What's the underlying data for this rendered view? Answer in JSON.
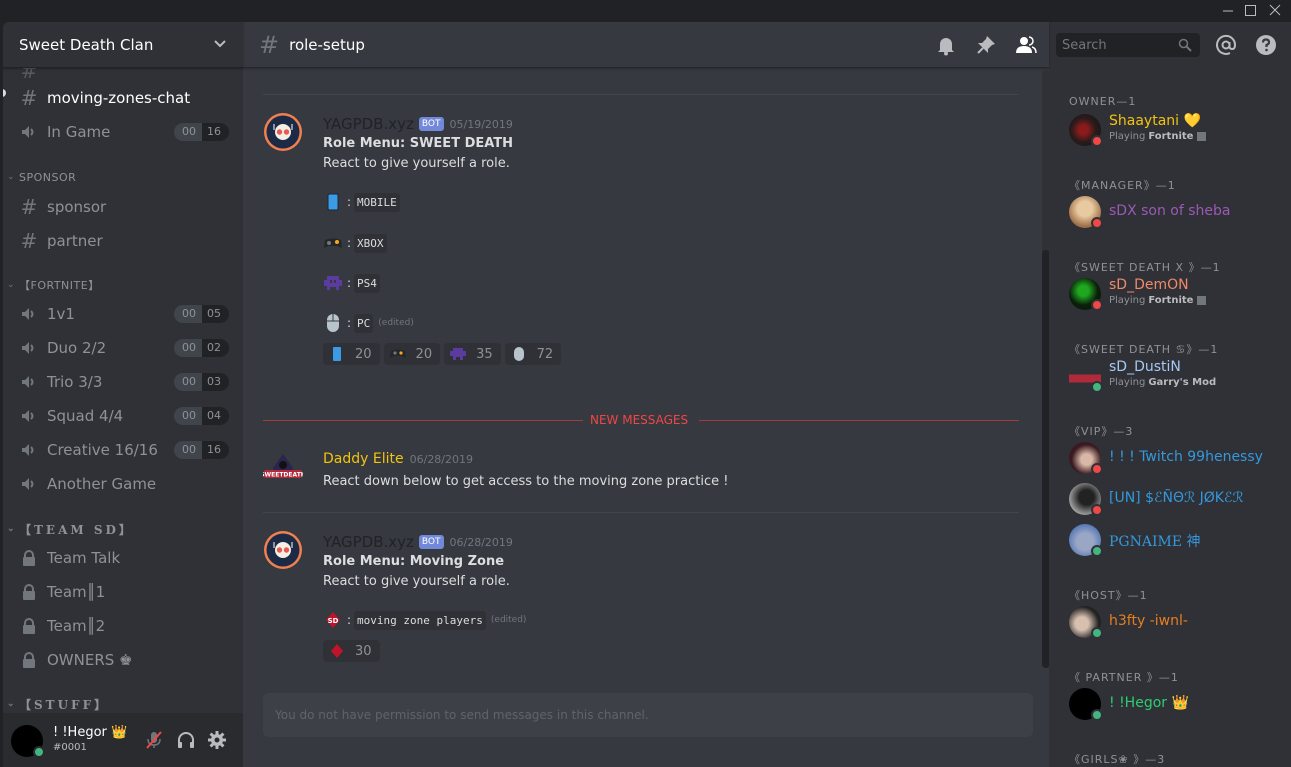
{
  "window": {
    "controls": [
      "minimize",
      "maximize",
      "close"
    ]
  },
  "guild": {
    "name": "Sweet Death Clan"
  },
  "sidebar": {
    "selected_channel": {
      "name": "moving-zones-chat",
      "type": "text"
    },
    "in_game": {
      "name": "In Game",
      "count_a": "00",
      "count_b": "16"
    },
    "categories": {
      "sponsor": "SPONSOR",
      "fortnite": "【FORTNITE】",
      "team_sd": "【TEAM SD】",
      "stuff": "【STUFF】"
    },
    "sponsor_channels": [
      {
        "name": "sponsor",
        "type": "text"
      },
      {
        "name": "partner",
        "type": "text"
      }
    ],
    "fortnite_channels": [
      {
        "name": "1v1",
        "count_a": "00",
        "count_b": "05"
      },
      {
        "name": "Duo 2/2",
        "count_a": "00",
        "count_b": "02"
      },
      {
        "name": "Trio 3/3",
        "count_a": "00",
        "count_b": "03"
      },
      {
        "name": "Squad 4/4",
        "count_a": "00",
        "count_b": "04"
      },
      {
        "name": "Creative 16/16",
        "count_a": "00",
        "count_b": "16"
      },
      {
        "name": "Another Game"
      }
    ],
    "team_channels": [
      {
        "name": "Team Talk"
      },
      {
        "name": "Team║1"
      },
      {
        "name": "Team║2"
      },
      {
        "name": "OWNERS ♚"
      }
    ]
  },
  "user_panel": {
    "username": "! !Hegor 👑",
    "discriminator": "#0001",
    "status": "online"
  },
  "chat": {
    "channel_name": "role-setup",
    "toolbar": {
      "search_placeholder": "Search"
    },
    "new_messages_label": "NEW MESSAGES",
    "input_placeholder": "You do not have permission to send messages in this channel.",
    "messages": [
      {
        "author": "YAGPDB.xyz",
        "bot_tag": "BOT",
        "timestamp": "05/19/2019",
        "title": "Role Menu: SWEET DEATH",
        "text": "React to give yourself a role.",
        "roles": [
          {
            "emoji": "mobile-phone",
            "label": "MOBILE",
            "edited": ""
          },
          {
            "emoji": "xbox-controller",
            "label": "XBOX",
            "edited": ""
          },
          {
            "emoji": "ps4-alien",
            "label": "PS4",
            "edited": ""
          },
          {
            "emoji": "pc-mouse",
            "label": "PC",
            "edited": "(edited)"
          }
        ],
        "reactions": [
          {
            "emoji": "mobile-phone",
            "count": "20"
          },
          {
            "emoji": "xbox-controller",
            "count": "20"
          },
          {
            "emoji": "ps4-alien",
            "count": "35"
          },
          {
            "emoji": "pc-mouse",
            "count": "72"
          }
        ]
      },
      {
        "author": "Daddy Elite",
        "author_color": "#f1c40f",
        "timestamp": "06/28/2019",
        "text": "React down below to get access to the moving zone practice !"
      },
      {
        "author": "YAGPDB.xyz",
        "bot_tag": "BOT",
        "timestamp": "06/28/2019",
        "title": "Role Menu: Moving Zone",
        "text": "React to give yourself a role.",
        "roles": [
          {
            "emoji": "sd-logo",
            "label": "moving zone players",
            "edited": "(edited)"
          }
        ],
        "reactions": [
          {
            "emoji": "sd-logo",
            "count": "30"
          }
        ]
      }
    ]
  },
  "members": {
    "groups": [
      {
        "label": "OWNER—1",
        "members": [
          {
            "name": "Shaaytani 💛",
            "color": "#f1c40f",
            "activity_prefix": "Playing",
            "activity": "Fortnite",
            "status": "dnd"
          }
        ]
      },
      {
        "label": "《MANAGER》—1",
        "members": [
          {
            "name": "sDX son of sheba",
            "color": "#9b59b6",
            "status": "dnd"
          }
        ]
      },
      {
        "label": "《SWEET DEATH X 》—1",
        "members": [
          {
            "name": "sD_DemON",
            "color": "#f0896a",
            "activity_prefix": "Playing",
            "activity": "Fortnite",
            "status": "dnd"
          }
        ]
      },
      {
        "label": "《SWEET DEATH ♋》—1",
        "members": [
          {
            "name": "sD_DustiN",
            "color": "#a5c8f5",
            "activity_prefix": "Playing",
            "activity": "Garry's Mod",
            "status": "online"
          }
        ]
      },
      {
        "label": "《VIP》—3",
        "members": [
          {
            "name": "! ! ! Twitch 99henessy",
            "color": "#3498db",
            "status": "dnd"
          },
          {
            "name": "[UN] $ℰÑΘℛ JØKℰℛ",
            "color": "#3498db",
            "status": "dnd"
          },
          {
            "name": "PGNAIME 神",
            "color": "#3498db",
            "status": "online"
          }
        ]
      },
      {
        "label": "《HOST》—1",
        "members": [
          {
            "name": "h3fty -iwnl-",
            "color": "#e67e22",
            "status": "online"
          }
        ]
      },
      {
        "label": "《 PARTNER 》—1",
        "members": [
          {
            "name": "! !Hegor 👑",
            "color": "#2ecc71",
            "status": "online"
          }
        ]
      },
      {
        "label": "《GIRLS❀ 》—3",
        "members": []
      }
    ]
  },
  "colors": {
    "accent": "#7289da",
    "online": "#43b581",
    "dnd": "#f04747",
    "new_messages": "#f04747"
  }
}
